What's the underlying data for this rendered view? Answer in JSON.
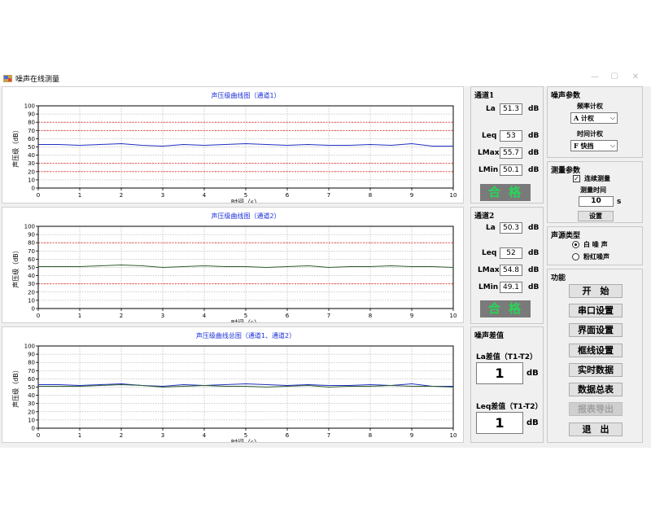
{
  "window": {
    "title": "噪声在线测量",
    "minimize": "—",
    "maximize": "☐",
    "close": "✕"
  },
  "charts": {
    "xlabel": "时间（s）",
    "ylabel": "声压级（dB）",
    "xticks": [
      "0",
      "1",
      "2",
      "3",
      "4",
      "5",
      "6",
      "7",
      "8",
      "9",
      "10"
    ],
    "yticks": [
      "0",
      "10",
      "20",
      "30",
      "40",
      "50",
      "60",
      "70",
      "80",
      "90",
      "100"
    ],
    "titles": [
      "声压级曲线图（通道1）",
      "声压级曲线图（通道2）",
      "声压级曲线总图（通道1、通道2）"
    ]
  },
  "chart_data": [
    {
      "type": "line",
      "title": "声压级曲线图（通道1）",
      "xlabel": "时间（s）",
      "ylabel": "声压级（dB）",
      "xlim": [
        0,
        10
      ],
      "ylim": [
        0,
        100
      ],
      "reference_lines": [
        20,
        30,
        70,
        80
      ],
      "x": [
        0,
        0.5,
        1,
        1.5,
        2,
        2.5,
        3,
        3.5,
        4,
        4.5,
        5,
        5.5,
        6,
        6.5,
        7,
        7.5,
        8,
        8.5,
        9,
        9.5,
        10
      ],
      "series": [
        {
          "color": "#1f2fbf",
          "values": [
            53,
            53,
            52,
            53,
            54,
            52,
            51,
            53,
            52,
            53,
            54,
            53,
            52,
            53,
            52,
            52,
            53,
            52,
            54,
            51,
            51
          ]
        }
      ]
    },
    {
      "type": "line",
      "title": "声压级曲线图（通道2）",
      "xlabel": "时间（s）",
      "ylabel": "声压级（dB）",
      "xlim": [
        0,
        10
      ],
      "ylim": [
        0,
        100
      ],
      "reference_lines": [
        30,
        80
      ],
      "x": [
        0,
        0.5,
        1,
        1.5,
        2,
        2.5,
        3,
        3.5,
        4,
        4.5,
        5,
        5.5,
        6,
        6.5,
        7,
        7.5,
        8,
        8.5,
        9,
        9.5,
        10
      ],
      "series": [
        {
          "color": "#2e5e2e",
          "values": [
            51,
            51,
            51,
            52,
            53,
            52,
            50,
            51,
            52,
            51,
            51,
            50,
            51,
            52,
            50,
            51,
            51,
            52,
            51,
            51,
            50
          ]
        }
      ]
    },
    {
      "type": "line",
      "title": "声压级曲线总图（通道1、通道2）",
      "xlabel": "时间（s）",
      "ylabel": "声压级（dB）",
      "xlim": [
        0,
        10
      ],
      "ylim": [
        0,
        100
      ],
      "reference_lines": [],
      "x": [
        0,
        0.5,
        1,
        1.5,
        2,
        2.5,
        3,
        3.5,
        4,
        4.5,
        5,
        5.5,
        6,
        6.5,
        7,
        7.5,
        8,
        8.5,
        9,
        9.5,
        10
      ],
      "series": [
        {
          "color": "#1f2fbf",
          "values": [
            53,
            53,
            52,
            53,
            54,
            52,
            51,
            53,
            52,
            53,
            54,
            53,
            52,
            53,
            52,
            52,
            53,
            52,
            54,
            51,
            51
          ]
        },
        {
          "color": "#2e5e2e",
          "values": [
            51,
            51,
            51,
            52,
            53,
            52,
            50,
            51,
            52,
            51,
            51,
            50,
            51,
            52,
            50,
            51,
            51,
            52,
            51,
            51,
            50
          ]
        }
      ]
    }
  ],
  "channel1": {
    "title": "通道1",
    "la_label": "La",
    "la": "51.3",
    "leq_label": "Leq",
    "leq": "53",
    "lmax_label": "LMax",
    "lmax": "55.7",
    "lmin_label": "LMin",
    "lmin": "50.1",
    "unit": "dB",
    "status": "合格",
    "status_color": "#27d657"
  },
  "channel2": {
    "title": "通道2",
    "la_label": "La",
    "la": "50.3",
    "leq_label": "Leq",
    "leq": "52",
    "lmax_label": "LMax",
    "lmax": "54.8",
    "lmin_label": "LMin",
    "lmin": "49.1",
    "unit": "dB",
    "status": "合格",
    "status_color": "#27d657"
  },
  "noise_diff": {
    "title": "噪声差值",
    "la_label": "La差值（T1-T2）",
    "la": "1",
    "leq_label": "Leq差值（T1-T2）",
    "leq": "1",
    "unit": "dB"
  },
  "noise_params": {
    "title": "噪声参数",
    "freq_label": "频率计权",
    "freq_value": "A 计权",
    "time_label": "时间计权",
    "time_value": "F 快挡"
  },
  "measure_params": {
    "title": "测量参数",
    "continuous_label": "连续测量",
    "continuous_checked": true,
    "time_label": "测量时间",
    "time_value": "10",
    "time_unit": "s",
    "set_button": "设置"
  },
  "source_type": {
    "title": "声源类型",
    "options": [
      "白 噪 声",
      "粉红噪声"
    ],
    "selected": 0
  },
  "functions": {
    "title": "功能",
    "buttons": [
      "开　始",
      "串口设置",
      "界面设置",
      "框线设置",
      "实时数据",
      "数据总表",
      "报表导出",
      "退　出"
    ],
    "disabled_index": 6
  }
}
